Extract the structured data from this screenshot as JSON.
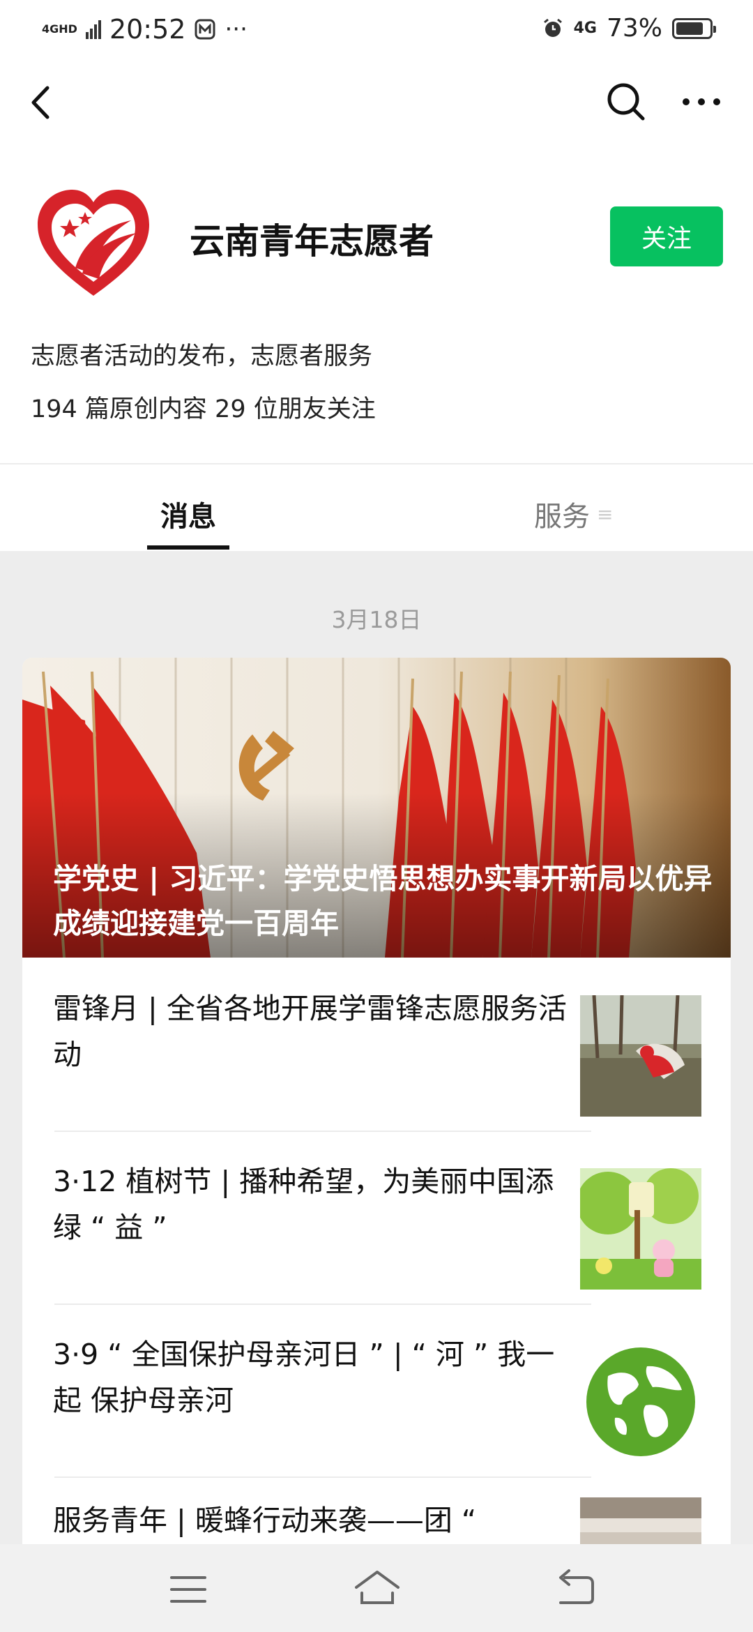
{
  "status_bar": {
    "signal_label": "4GHD",
    "time": "20:52",
    "network": "4G",
    "battery": "73%",
    "battery_level": 0.73
  },
  "profile": {
    "name": "云南青年志愿者",
    "follow_label": "关注",
    "description": "志愿者活动的发布，志愿者服务",
    "stats": "194 篇原创内容  29 位朋友关注"
  },
  "tabs": [
    {
      "label": "消息",
      "active": true
    },
    {
      "label": "服务",
      "active": false,
      "icon": "menu-icon"
    }
  ],
  "date_label": "3月18日",
  "feature": {
    "title": "学党史 | 习近平：学党史悟思想办实事开新局以优异成绩迎接建党一百周年"
  },
  "articles": [
    {
      "title": "雷锋月 | 全省各地开展学雷锋志愿服务活动",
      "thumb": "volunteer-photo"
    },
    {
      "title": "3·12 植树节 | 播种希望，为美丽中国添绿 “ 益 ”",
      "thumb": "arbor-day-illustration"
    },
    {
      "title": "3·9 “ 全国保护母亲河日 ” | “ 河 ” 我一起 保护母亲河",
      "thumb": "green-earth-globe"
    },
    {
      "title": "服务青年 | 暖蜂行动来袭——团 “",
      "thumb": "room-photo"
    }
  ],
  "colors": {
    "accent": "#07c160",
    "background": "#ededed"
  }
}
